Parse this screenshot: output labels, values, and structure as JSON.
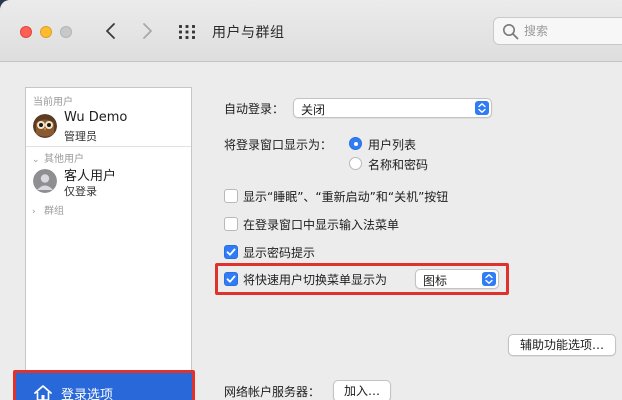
{
  "window": {
    "title": "用户与群组"
  },
  "search": {
    "placeholder": "搜索"
  },
  "sidebar": {
    "current_users_header": "当前用户",
    "current_user": {
      "name": "Wu Demo",
      "role": "管理员"
    },
    "other_users_header": "其他用户",
    "guest_user": {
      "name": "客人用户",
      "role": "仅登录"
    },
    "groups_header": "群组",
    "login_options_label": "登录选项"
  },
  "main": {
    "auto_login_label": "自动登录：",
    "auto_login_value": "关闭",
    "display_login_window_label": "将登录窗口显示为：",
    "radio_user_list": "用户列表",
    "radio_name_password": "名称和密码",
    "radio_selected": "user_list",
    "check_show_buttons": "显示“睡眠”、“重新启动”和“关机”按钮",
    "check_show_buttons_checked": false,
    "check_input_menu": "在登录窗口中显示输入法菜单",
    "check_input_menu_checked": false,
    "check_password_hints": "显示密码提示",
    "check_password_hints_checked": true,
    "check_fast_user_switch": "将快速用户切换菜单显示为",
    "check_fast_user_switch_checked": true,
    "fast_user_switch_value": "图标",
    "accessibility_button": "辅助功能选项…",
    "network_account_label": "网络帐户服务器：",
    "join_button": "加入…"
  },
  "colors": {
    "accent": "#2f7cf6",
    "highlight_border": "#e0322c",
    "sidebar_selected": "#2968d8"
  }
}
